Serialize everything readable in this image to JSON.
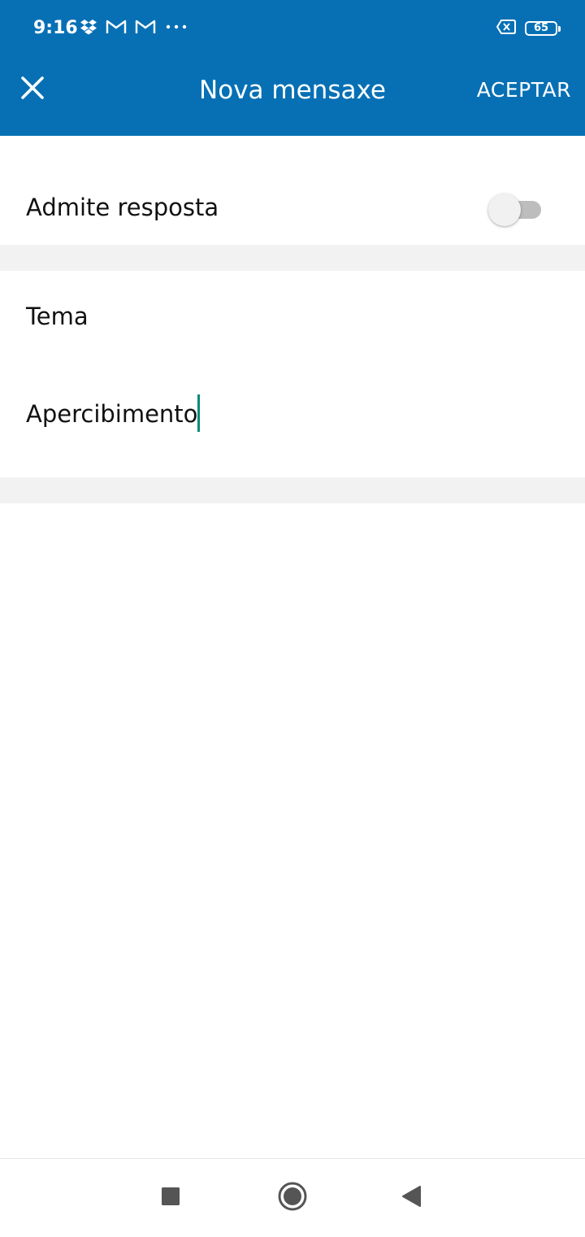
{
  "status_bar": {
    "time": "9:16",
    "battery_level": "65",
    "left_icons": [
      "dropbox-icon",
      "gmail-icon",
      "gmail-icon",
      "more-notifications-icon"
    ],
    "right_icons": [
      "no-sim-icon",
      "battery-icon"
    ]
  },
  "appbar": {
    "title": "Nova mensaxe",
    "accept_label": "ACEPTAR",
    "close_icon": "close-icon"
  },
  "reply_setting": {
    "label": "Admite resposta",
    "enabled": false
  },
  "form": {
    "subject_placeholder": "Tema",
    "message_value": "Apercibimento"
  },
  "colors": {
    "primary": "#0770b5",
    "caret": "#0a8a7a",
    "divider": "#f2f2f2",
    "switch_track_off": "#bdbdbd",
    "switch_thumb_off": "#f1f1f1"
  },
  "navigation": {
    "buttons": [
      "recent-apps-icon",
      "home-icon",
      "back-icon"
    ]
  }
}
